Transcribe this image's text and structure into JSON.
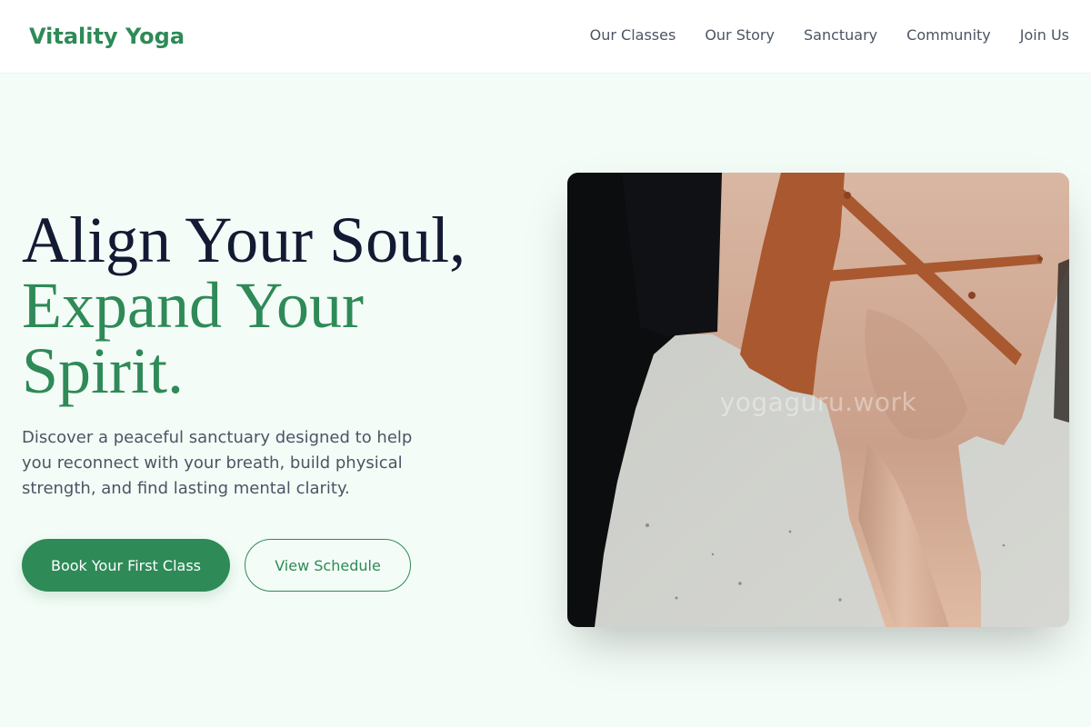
{
  "brand": {
    "name": "Vitality Yoga",
    "color": "#2e8a57"
  },
  "nav": {
    "items": [
      {
        "label": "Our Classes"
      },
      {
        "label": "Our Story"
      },
      {
        "label": "Sanctuary"
      },
      {
        "label": "Community"
      },
      {
        "label": "Join Us"
      }
    ]
  },
  "hero": {
    "headline_line1": "Align Your Soul,",
    "headline_accent": "Expand Your Spirit.",
    "subtext": "Discover a peaceful sanctuary designed to help you reconnect with your breath, build physical strength, and find lasting mental clarity.",
    "primary_button": "Book Your First Class",
    "secondary_button": "View Schedule",
    "image_watermark": "yogaguru.work",
    "image_subject": "yoga-pose-photo"
  },
  "colors": {
    "accent": "#2e8a57",
    "heading": "#131a33",
    "body_text": "#4b5563",
    "page_background": "#f4fcf7"
  }
}
